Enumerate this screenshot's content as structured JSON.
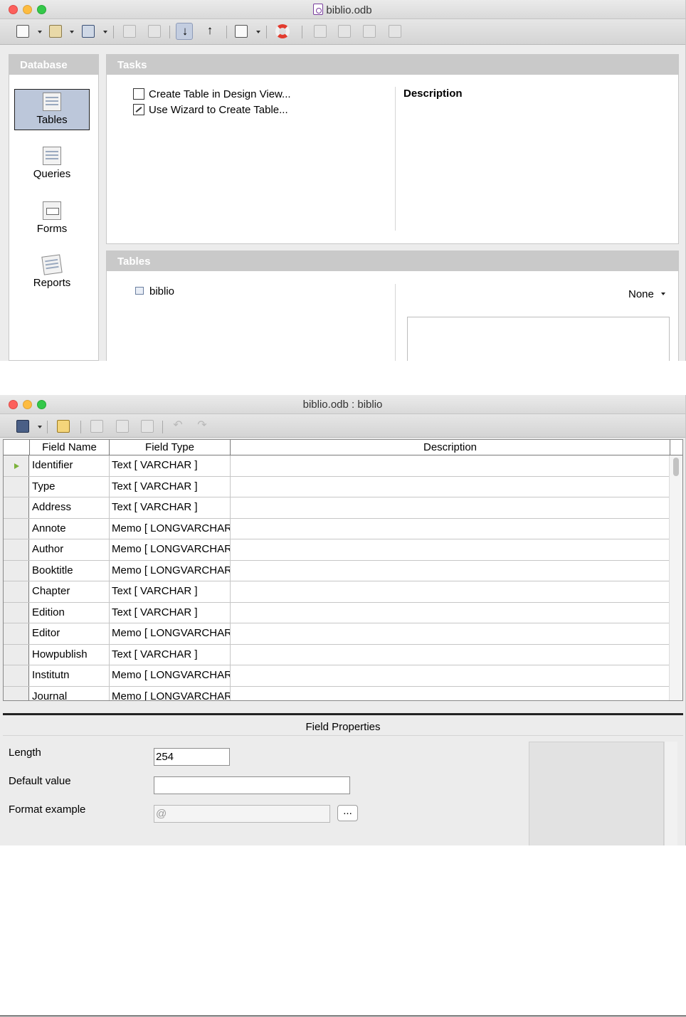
{
  "window1": {
    "title": "biblio.odb",
    "database_pane": {
      "header": "Database",
      "items": [
        {
          "label": "Tables",
          "icon": "tables-icon",
          "selected": true
        },
        {
          "label": "Queries",
          "icon": "queries-icon",
          "selected": false
        },
        {
          "label": "Forms",
          "icon": "forms-icon",
          "selected": false
        },
        {
          "label": "Reports",
          "icon": "reports-icon",
          "selected": false
        }
      ]
    },
    "tasks_pane": {
      "header": "Tasks",
      "tasks": [
        {
          "label": "Create Table in Design View..."
        },
        {
          "label": "Use Wizard to Create Table..."
        }
      ],
      "description_title": "Description"
    },
    "tables_pane": {
      "header": "Tables",
      "tables": [
        {
          "label": "biblio"
        }
      ],
      "preview_mode": "None"
    }
  },
  "window2": {
    "title": "biblio.odb : biblio",
    "grid": {
      "columns": [
        "Field Name",
        "Field Type",
        "Description"
      ],
      "rows": [
        {
          "name": "Identifier",
          "type": "Text [ VARCHAR ]",
          "description": "",
          "current": true
        },
        {
          "name": "Type",
          "type": "Text [ VARCHAR ]",
          "description": ""
        },
        {
          "name": "Address",
          "type": "Text [ VARCHAR ]",
          "description": ""
        },
        {
          "name": "Annote",
          "type": "Memo [ LONGVARCHAR ]",
          "description": ""
        },
        {
          "name": "Author",
          "type": "Memo [ LONGVARCHAR ]",
          "description": ""
        },
        {
          "name": "Booktitle",
          "type": "Memo [ LONGVARCHAR ]",
          "description": ""
        },
        {
          "name": "Chapter",
          "type": "Text [ VARCHAR ]",
          "description": ""
        },
        {
          "name": "Edition",
          "type": "Text [ VARCHAR ]",
          "description": ""
        },
        {
          "name": "Editor",
          "type": "Memo [ LONGVARCHAR ]",
          "description": ""
        },
        {
          "name": "Howpublish",
          "type": "Text [ VARCHAR ]",
          "description": ""
        },
        {
          "name": "Institutn",
          "type": "Memo [ LONGVARCHAR ]",
          "description": ""
        },
        {
          "name": "Journal",
          "type": "Memo [ LONGVARCHAR ]",
          "description": ""
        }
      ]
    },
    "field_properties": {
      "title": "Field Properties",
      "length_label": "Length",
      "length_value": "254",
      "default_label": "Default value",
      "default_value": "",
      "format_label": "Format example",
      "format_value": "@",
      "browse_label": "..."
    }
  }
}
